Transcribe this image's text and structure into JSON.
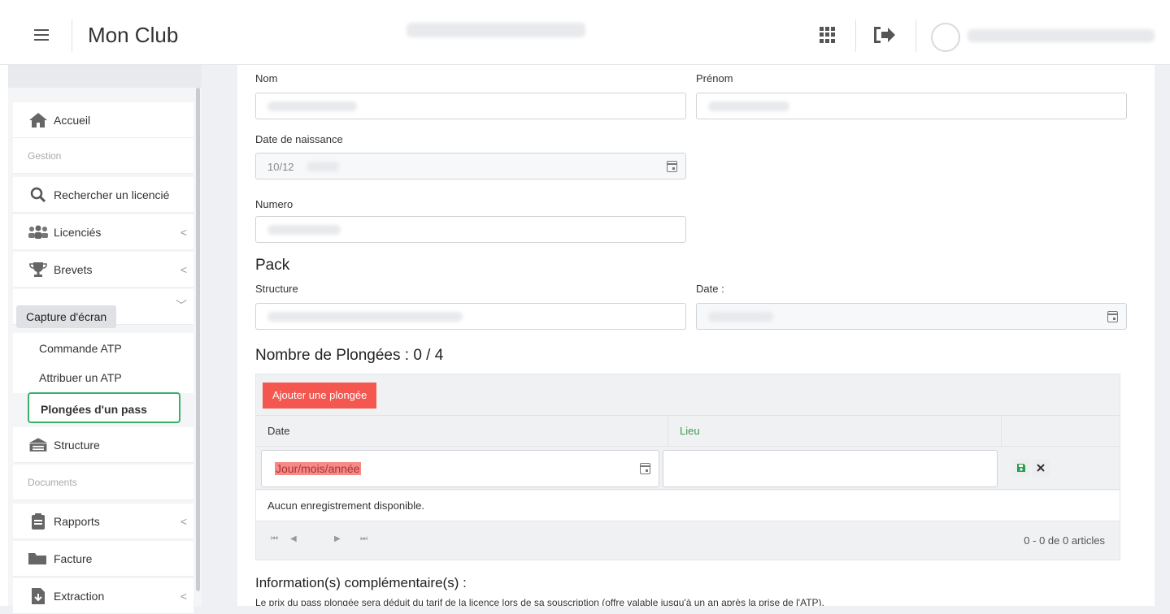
{
  "header": {
    "app_title": "Mon Club",
    "icons": [
      "hamburger-icon",
      "apps-grid-icon",
      "logout-icon",
      "avatar"
    ]
  },
  "sidebar": {
    "accueil": "Accueil",
    "section_gestion": "Gestion",
    "rechercher": "Rechercher un licencié",
    "licencies": "Licenciés",
    "brevets": "Brevets",
    "tooltip": "Capture d'écran",
    "commande_atp": "Commande ATP",
    "attribuer_atp": "Attribuer un ATP",
    "plongees_pass": "Plongées d'un pass",
    "structure": "Structure",
    "section_documents": "Documents",
    "rapports": "Rapports",
    "facture": "Facture",
    "extraction": "Extraction",
    "chevron": "<",
    "chevron_down": "﹀"
  },
  "form": {
    "nom_label": "Nom",
    "prenom_label": "Prénom",
    "date_naissance_label": "Date de naissance",
    "date_naissance_value": "10/12",
    "numero_label": "Numero",
    "pack_title": "Pack",
    "structure_label": "Structure",
    "date_label": "Date :"
  },
  "dives": {
    "title": "Nombre de Plongées : 0 / 4",
    "add_button": "Ajouter une plongée",
    "col_date": "Date",
    "col_lieu": "Lieu",
    "date_placeholder": "Jour/mois/année",
    "no_records": "Aucun enregistrement disponible.",
    "pager_first": "⏮",
    "pager_prev": "◀",
    "pager_next": "▶",
    "pager_last": "⏭",
    "pager_info": "0 - 0 de 0 articles"
  },
  "info": {
    "title": "Information(s) complémentaire(s) :",
    "text": "Le prix du pass plongée sera déduit du tarif de la licence lors de sa souscription (offre valable jusqu'à un an après la prise de l'ATP)."
  },
  "colors": {
    "accent_green": "#3bb06a",
    "button_red": "#f4574f",
    "lieu_header": "#3a9a4a"
  }
}
